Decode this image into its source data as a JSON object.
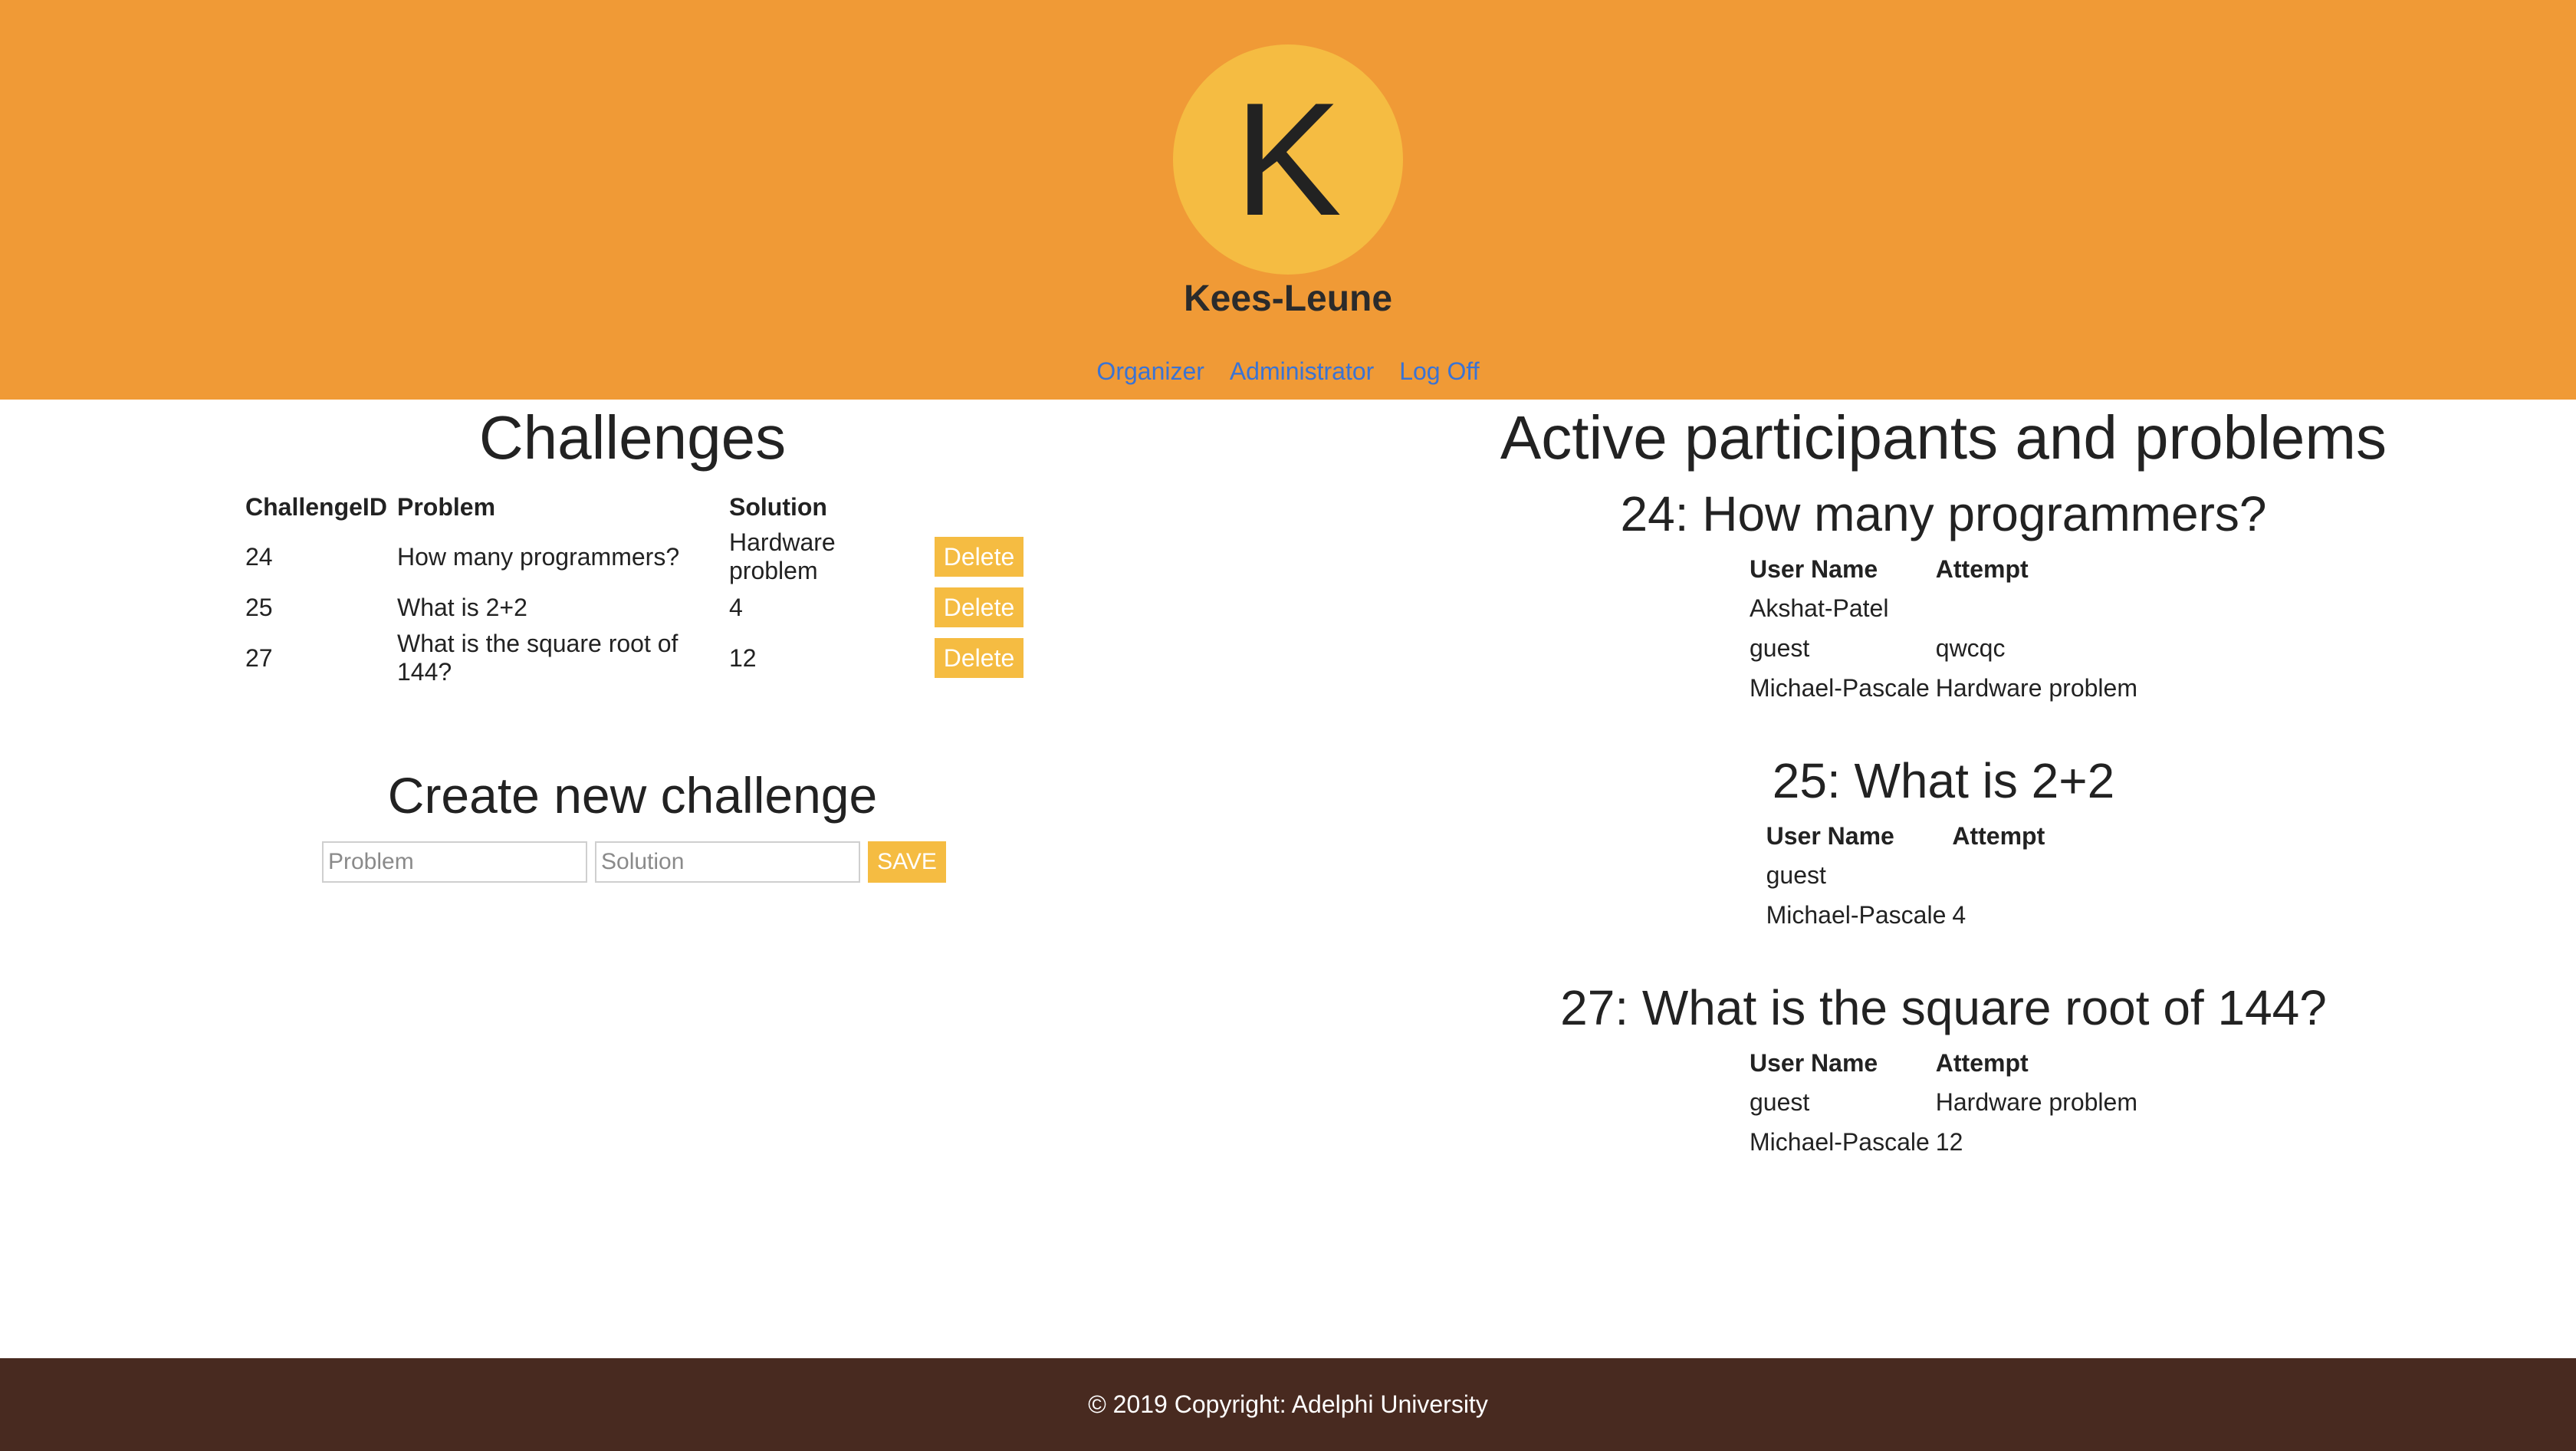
{
  "header": {
    "avatar_letter": "K",
    "username": "Kees-Leune",
    "nav": [
      "Organizer",
      "Administrator",
      "Log Off"
    ]
  },
  "challenges": {
    "title": "Challenges",
    "columns": [
      "ChallengeID",
      "Problem",
      "Solution"
    ],
    "rows": [
      {
        "id": "24",
        "problem": "How many programmers?",
        "solution": "Hardware problem",
        "action": "Delete"
      },
      {
        "id": "25",
        "problem": "What is 2+2",
        "solution": "4",
        "action": "Delete"
      },
      {
        "id": "27",
        "problem": "What is the square root of 144?",
        "solution": "12",
        "action": "Delete"
      }
    ]
  },
  "create": {
    "title": "Create new challenge",
    "problem_placeholder": "Problem",
    "solution_placeholder": "Solution",
    "save_label": "SAVE"
  },
  "active": {
    "title": "Active participants and problems",
    "columns": [
      "User Name",
      "Attempt"
    ],
    "groups": [
      {
        "heading": "24: How many programmers?",
        "rows": [
          {
            "user": "Akshat-Patel",
            "attempt": ""
          },
          {
            "user": "guest",
            "attempt": "qwcqc"
          },
          {
            "user": "Michael-Pascale",
            "attempt": "Hardware problem"
          }
        ]
      },
      {
        "heading": "25: What is 2+2",
        "rows": [
          {
            "user": "guest",
            "attempt": ""
          },
          {
            "user": "Michael-Pascale",
            "attempt": "4"
          }
        ]
      },
      {
        "heading": "27: What is the square root of 144?",
        "rows": [
          {
            "user": "guest",
            "attempt": "Hardware problem"
          },
          {
            "user": "Michael-Pascale",
            "attempt": "12"
          }
        ]
      }
    ]
  },
  "footer": {
    "text": "© 2019 Copyright: Adelphi University"
  },
  "colors": {
    "header_bg": "#f09a36",
    "avatar_bg": "#f5bc42",
    "button_bg": "#f5bc42",
    "link": "#3a73d4",
    "footer_bg": "#482a20"
  }
}
